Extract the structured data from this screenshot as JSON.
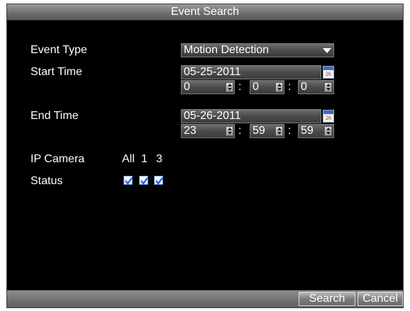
{
  "window": {
    "title": "Event Search"
  },
  "form": {
    "event_type": {
      "label": "Event Type",
      "value": "Motion Detection"
    },
    "start_time": {
      "label": "Start Time",
      "date": "05-25-2011",
      "hour": "0",
      "minute": "0",
      "second": "0"
    },
    "end_time": {
      "label": "End Time",
      "date": "05-26-2011",
      "hour": "23",
      "minute": "59",
      "second": "59"
    },
    "ip_camera": {
      "label": "IP Camera",
      "options": [
        "All",
        "1",
        "3"
      ]
    },
    "status": {
      "label": "Status",
      "checked": [
        true,
        true,
        true
      ]
    },
    "time_separator": ":"
  },
  "calendar_icon_day": "26",
  "buttons": {
    "search": "Search",
    "cancel": "Cancel"
  },
  "colors": {
    "background": "#000000",
    "text": "#ffffff",
    "checkbox_border": "#4a74c9"
  },
  "icons": {
    "calendar": "calendar-icon",
    "dropdown": "chevron-down-icon",
    "spinner": "spinner-icon",
    "checkbox": "checkbox-icon"
  }
}
